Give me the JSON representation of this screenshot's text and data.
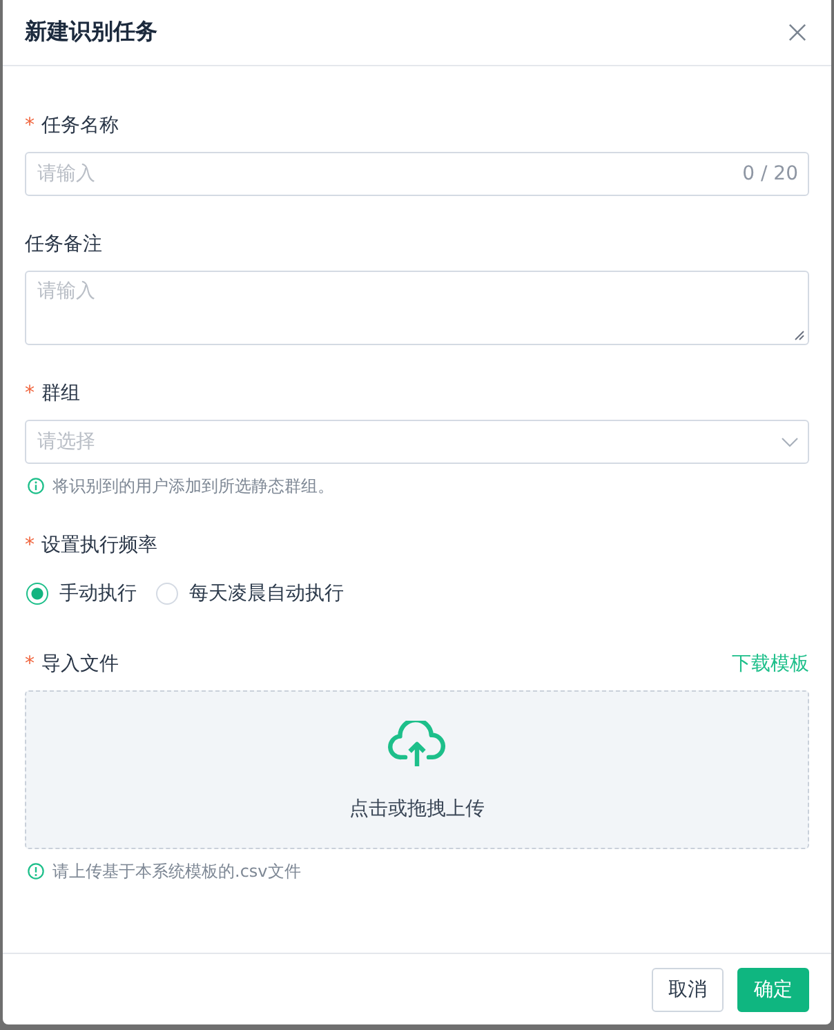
{
  "dialog": {
    "title": "新建识别任务"
  },
  "fields": [
    {
      "kind": "text",
      "label": "任务名称",
      "required_mark": "*",
      "placeholder": "请输入",
      "counter": "0 / 20"
    },
    {
      "kind": "textarea",
      "label": "任务备注",
      "placeholder": "请输入"
    },
    {
      "kind": "select",
      "label": "群组",
      "required_mark": "*",
      "placeholder": "请选择",
      "help": "将识别到的用户添加到所选静态群组。"
    },
    {
      "kind": "radio",
      "label": "设置执行频率",
      "required_mark": "*",
      "options": [
        {
          "label": "手动执行",
          "selected": true
        },
        {
          "label": "每天凌晨自动执行",
          "selected": false
        }
      ]
    },
    {
      "kind": "upload",
      "label": "导入文件",
      "required_mark": "*",
      "link": "下载模板",
      "prompt": "点击或拖拽上传",
      "help": "请上传基于本系统模板的.csv文件"
    }
  ],
  "buttons": [
    {
      "label": "取消",
      "kind": "default"
    },
    {
      "label": "确定",
      "kind": "primary"
    }
  ]
}
